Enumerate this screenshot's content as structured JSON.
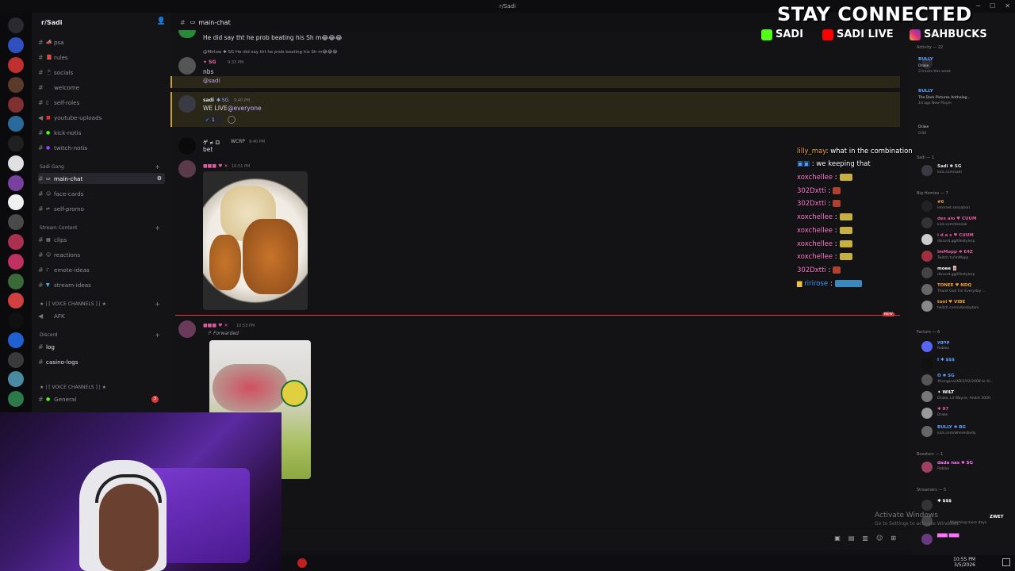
{
  "window": {
    "title": "r/Sadi"
  },
  "server": {
    "name": "r/Sadi"
  },
  "categories": {
    "sadi_gang": "Sadi Gang",
    "stream_content": "Stream Content",
    "voice_channels_1": "★ | [ VOICE CHANNELS ] | ★",
    "discord": "Discord",
    "voice_channels_2": "★ | [ VOICE CHANNELS ] | ★"
  },
  "channels": {
    "psa": "psa",
    "rules": "rules",
    "socials": "socials",
    "welcome": "welcome",
    "self_roles": "self-roles",
    "youtube_uploads": "youtube-uploads",
    "kick_notis": "kick-notis",
    "twitch_notis": "twitch-notis",
    "main_chat": "main-chat",
    "face_cards": "face-cards",
    "self_promo": "self-promo",
    "clips": "clips",
    "reactions": "reactions",
    "emote_ideas": "emote-ideas",
    "stream_ideas": "stream-ideas",
    "afk": "AFK",
    "log": "log",
    "casino_logs": "casino-logs",
    "general": "General",
    "general_badge": "3"
  },
  "header": {
    "channel": "main-chat"
  },
  "messages": {
    "m1_text": "He did say tht he prob beating his Sh m😂😂😂",
    "m2_reply": "@Mirlow ✱ SG  He did say tht he prob beating his Sh m😂😂😂",
    "m2_name": "✦ SG",
    "m2_time": "9:33 PM",
    "m2_text": "nbs",
    "m2_mention": "@sadi",
    "m3_name": "sadi",
    "m3_tag": "✱ SG",
    "m3_time": "9:40 PM",
    "m3_text": "WE LIVE",
    "m3_everyone": "@everyone",
    "m3_reaction": "1",
    "m4_name": "ゲ ≠ ロ",
    "m4_tag": "WCRP",
    "m4_time": "9:40 PM",
    "m4_text": "bet",
    "m5_time": "10:51 PM",
    "m6_time": "10:53 PM",
    "m6_forwarded": "Forwarded",
    "new_label": "NEW"
  },
  "overlay": {
    "title": "STAY CONNECTED",
    "kick": "SADI",
    "youtube": "SADI LIVE",
    "instagram": "SAHBUCKS"
  },
  "livechat": [
    {
      "user": "lilly_may",
      "text": ": what in the combination",
      "color": "#f0a030"
    },
    {
      "user": "",
      "text": ": we keeping that",
      "color": "#4aa0ff"
    },
    {
      "user": "xoxchellee",
      "text": " :",
      "color": "#ff7ad0"
    },
    {
      "user": "302Dxtti",
      "text": " :",
      "color": "#ff7ad0"
    },
    {
      "user": "302Dxtti",
      "text": " :",
      "color": "#ff7ad0"
    },
    {
      "user": "xoxchellee",
      "text": " :",
      "color": "#ff7ad0"
    },
    {
      "user": "xoxchellee",
      "text": " :",
      "color": "#ff7ad0"
    },
    {
      "user": "xoxchellee",
      "text": " :",
      "color": "#ff7ad0"
    },
    {
      "user": "xoxchellee",
      "text": " :",
      "color": "#ff7ad0"
    },
    {
      "user": "302Dxtti",
      "text": " :",
      "color": "#ff7ad0"
    },
    {
      "user": "ririrose",
      "text": " :",
      "color": "#4aa0ff"
    }
  ],
  "members": {
    "activity": "Activity — 22",
    "act1_name": "BULLY",
    "act1_sub": "Drake",
    "act1_sub2": "3 tracks this week",
    "act2_name": "BULLY",
    "act2_sub": "The Dark Pictures Antholog...",
    "act2_sub2": "1d ago  New Player",
    "act3_sub": "Drake",
    "act3_sub2": "0:00",
    "sadi_cat": "Sadi — 1",
    "sadi_name": "Sadi ✱ SG",
    "sadi_status": "kick.com/sadi",
    "homies_cat": "Big Homies — 7",
    "h1": "#6",
    "h1s": "Internet sensation",
    "h2": "des aio ♥ CUUM",
    "h2s": "kick.com/desoak",
    "h3": "i d a s ♥ CUUM",
    "h3s": "discord.gg/lifestylerp",
    "h4": "ImMopp ✱ E4Z",
    "h4s": "Twitch.tv/imMopp",
    "h5": "moee 🀄",
    "h5s": "discord.gg/lifestylerp",
    "h6": "TONEE ♥ NDQ",
    "h6s": "Thank God For Everyday ...",
    "h7": "tonl ♥ VIBE",
    "h7s": "twitch.com/vibesbytoni",
    "factors_cat": "Factors — 6",
    "f1": "ygnp",
    "f1s": "Roblox",
    "f2": "I ✱ $$$",
    "f3": "O ✱ SG",
    "f3s": "#LongLiveXDi2/02/2008 to 4/...",
    "f4": "✦ WILT",
    "f4s": "Drake, Lil Wayne, André 3000",
    "f5": "✱ 97",
    "f5s": "Drake",
    "f6": "BULLY ✱ BG",
    "f6s": "kick.com/wheresbully",
    "boosters_cat": "Boosters — 1",
    "b1": "dada nas ✱ SG",
    "b1s": "Roblox",
    "streamers_cat": "Streamers — 5",
    "s1": "✱ $$$",
    "s2": "ZWET",
    "s2s": "Watching more days"
  },
  "watermark": {
    "line1": "Activate Windows",
    "line2": "Go to Settings to activate Windows."
  },
  "taskbar": {
    "time": "10:55 PM",
    "date": "3/5/2026"
  }
}
